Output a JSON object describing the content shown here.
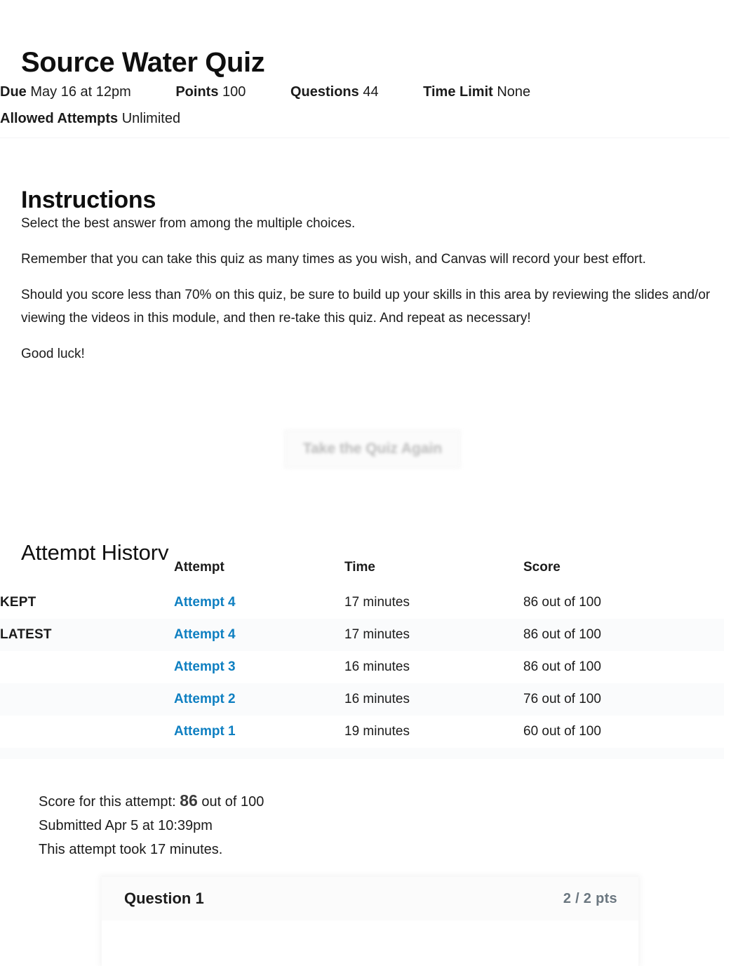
{
  "quiz": {
    "title": "Source Water Quiz",
    "meta_line1": [
      {
        "label": "Due",
        "value": "May 16 at 12pm"
      },
      {
        "label": "Points",
        "value": "100"
      },
      {
        "label": "Questions",
        "value": "44"
      },
      {
        "label": "Time Limit",
        "value": "None"
      }
    ],
    "meta_line2": [
      {
        "label": "Allowed Attempts",
        "value": "Unlimited"
      }
    ]
  },
  "instructions": {
    "heading": "Instructions",
    "paragraphs": [
      "Select the best answer from among the multiple choices.",
      "Remember that you can take this quiz as many times as you wish, and Canvas will record your best effort.",
      "Should you score less than 70% on this quiz, be sure to build up your skills in this area by reviewing the slides and/or viewing the videos in this module, and then re-take this quiz.  And repeat as necessary!",
      "Good luck!"
    ]
  },
  "actions": {
    "retake_label": "Take the Quiz Again"
  },
  "attempt_history": {
    "heading": "Attempt History",
    "columns": [
      "",
      "Attempt",
      "Time",
      "Score"
    ],
    "rows": [
      {
        "flag": "KEPT",
        "attempt": "Attempt 4",
        "time": "17 minutes",
        "score": "86 out of 100"
      },
      {
        "flag": "LATEST",
        "attempt": "Attempt 4",
        "time": "17 minutes",
        "score": "86 out of 100"
      },
      {
        "flag": "",
        "attempt": "Attempt 3",
        "time": "16 minutes",
        "score": "86 out of 100"
      },
      {
        "flag": "",
        "attempt": "Attempt 2",
        "time": "16 minutes",
        "score": "76 out of 100"
      },
      {
        "flag": "",
        "attempt": "Attempt 1",
        "time": "19 minutes",
        "score": "60 out of 100"
      }
    ]
  },
  "attempt_summary": {
    "score_prefix": "Score for this attempt:",
    "score_value": "86",
    "score_suffix": "out of 100",
    "submitted": "Submitted Apr 5 at 10:39pm",
    "duration": "This attempt took 17 minutes."
  },
  "question": {
    "name": "Question 1",
    "points": "2 / 2 pts"
  },
  "colors": {
    "link": "#0e7fc1",
    "text": "#1b1b1b",
    "muted": "#6b7780",
    "row_stripe": "#fafbfc"
  }
}
